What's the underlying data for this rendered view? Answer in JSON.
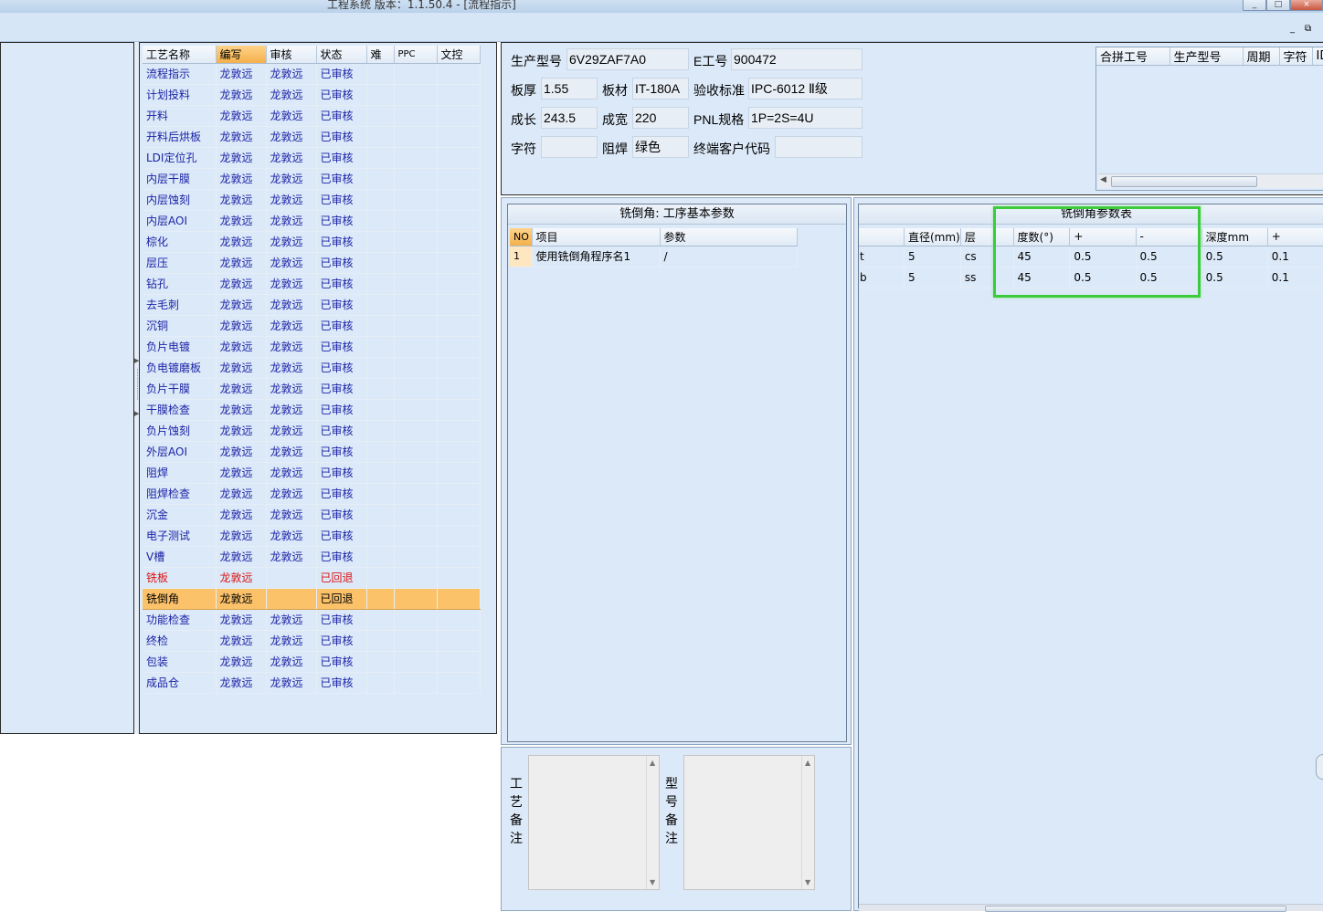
{
  "window": {
    "title": "工程系统   版本：1.1.50.4 - [流程指示]",
    "controls": [
      "_",
      "□",
      "×"
    ],
    "mdi_controls": [
      "_",
      "⧉"
    ]
  },
  "process_grid": {
    "headers": [
      "工艺名称",
      "编写",
      "审核",
      "状态",
      "难",
      "PPC",
      "文控"
    ],
    "rows": [
      {
        "name": "流程指示",
        "writer": "龙敦远",
        "reviewer": "龙敦远",
        "status": "已审核"
      },
      {
        "name": "计划投料",
        "writer": "龙敦远",
        "reviewer": "龙敦远",
        "status": "已审核"
      },
      {
        "name": "开料",
        "writer": "龙敦远",
        "reviewer": "龙敦远",
        "status": "已审核"
      },
      {
        "name": "开料后烘板",
        "writer": "龙敦远",
        "reviewer": "龙敦远",
        "status": "已审核"
      },
      {
        "name": "LDI定位孔",
        "writer": "龙敦远",
        "reviewer": "龙敦远",
        "status": "已审核"
      },
      {
        "name": "内层干膜",
        "writer": "龙敦远",
        "reviewer": "龙敦远",
        "status": "已审核"
      },
      {
        "name": "内层蚀刻",
        "writer": "龙敦远",
        "reviewer": "龙敦远",
        "status": "已审核"
      },
      {
        "name": "内层AOI",
        "writer": "龙敦远",
        "reviewer": "龙敦远",
        "status": "已审核"
      },
      {
        "name": "棕化",
        "writer": "龙敦远",
        "reviewer": "龙敦远",
        "status": "已审核"
      },
      {
        "name": "层压",
        "writer": "龙敦远",
        "reviewer": "龙敦远",
        "status": "已审核"
      },
      {
        "name": "钻孔",
        "writer": "龙敦远",
        "reviewer": "龙敦远",
        "status": "已审核"
      },
      {
        "name": "去毛刺",
        "writer": "龙敦远",
        "reviewer": "龙敦远",
        "status": "已审核"
      },
      {
        "name": "沉铜",
        "writer": "龙敦远",
        "reviewer": "龙敦远",
        "status": "已审核"
      },
      {
        "name": "负片电镀",
        "writer": "龙敦远",
        "reviewer": "龙敦远",
        "status": "已审核"
      },
      {
        "name": "负电镀磨板",
        "writer": "龙敦远",
        "reviewer": "龙敦远",
        "status": "已审核"
      },
      {
        "name": "负片干膜",
        "writer": "龙敦远",
        "reviewer": "龙敦远",
        "status": "已审核"
      },
      {
        "name": "干膜检查",
        "writer": "龙敦远",
        "reviewer": "龙敦远",
        "status": "已审核"
      },
      {
        "name": "负片蚀刻",
        "writer": "龙敦远",
        "reviewer": "龙敦远",
        "status": "已审核"
      },
      {
        "name": "外层AOI",
        "writer": "龙敦远",
        "reviewer": "龙敦远",
        "status": "已审核"
      },
      {
        "name": "阻焊",
        "writer": "龙敦远",
        "reviewer": "龙敦远",
        "status": "已审核"
      },
      {
        "name": "阻焊检查",
        "writer": "龙敦远",
        "reviewer": "龙敦远",
        "status": "已审核"
      },
      {
        "name": "沉金",
        "writer": "龙敦远",
        "reviewer": "龙敦远",
        "status": "已审核"
      },
      {
        "name": "电子测试",
        "writer": "龙敦远",
        "reviewer": "龙敦远",
        "status": "已审核"
      },
      {
        "name": "V槽",
        "writer": "龙敦远",
        "reviewer": "龙敦远",
        "status": "已审核"
      },
      {
        "name": "铣板",
        "writer": "龙敦远",
        "reviewer": "",
        "status": "已回退",
        "state": "red"
      },
      {
        "name": "铣倒角",
        "writer": "龙敦远",
        "reviewer": "",
        "status": "已回退",
        "state": "selected"
      },
      {
        "name": "功能检查",
        "writer": "龙敦远",
        "reviewer": "龙敦远",
        "status": "已审核"
      },
      {
        "name": "终检",
        "writer": "龙敦远",
        "reviewer": "龙敦远",
        "status": "已审核"
      },
      {
        "name": "包装",
        "writer": "龙敦远",
        "reviewer": "龙敦远",
        "status": "已审核"
      },
      {
        "name": "成品仓",
        "writer": "龙敦远",
        "reviewer": "龙敦远",
        "status": "已审核"
      }
    ]
  },
  "info": {
    "model_label": "生产型号",
    "model": "6V29ZAF7A0",
    "eno_label": "E工号",
    "eno": "900472",
    "thickness_label": "板厚",
    "thickness": "1.55",
    "material_label": "板材",
    "material": "IT-180A",
    "standard_label": "验收标准",
    "standard": "IPC-6012 Ⅱ级",
    "length_label": "成长",
    "length": "243.5",
    "width_label": "成宽",
    "width": "220",
    "pnl_label": "PNL规格",
    "pnl": "1P=2S=4U",
    "char_label": "字符",
    "char": "",
    "mask_label": "阻焊",
    "mask": "绿色",
    "customer_label": "终端客户代码",
    "customer": ""
  },
  "combined_grid": {
    "headers": [
      "合拼工号",
      "生产型号",
      "周期",
      "字符",
      "ID"
    ]
  },
  "basic_params": {
    "title": "铣倒角: 工序基本参数",
    "headers": [
      "NO",
      "项目",
      "参数"
    ],
    "rows": [
      {
        "no": "1",
        "item": "使用铣倒角程序名1",
        "param": "/"
      }
    ]
  },
  "chamfer_table": {
    "title": "铣倒角参数表",
    "headers": [
      "",
      "直径(mm)",
      "层",
      "度数(°)",
      "+",
      "-",
      "深度mm",
      "+"
    ],
    "rows": [
      [
        "t",
        "5",
        "cs",
        "45",
        "0.5",
        "0.5",
        "0.5",
        "0.1"
      ],
      [
        "b",
        "5",
        "ss",
        "45",
        "0.5",
        "0.5",
        "0.5",
        "0.1"
      ]
    ]
  },
  "remarks": {
    "process_label": "工艺备注",
    "model_label": "型号备注",
    "process_text": "",
    "model_text": ""
  },
  "colors": {
    "panel_bg": "#dce9f8",
    "link_text": "#1a23a6",
    "error_text": "#d91616",
    "selection": "#fbc26a",
    "highlight_box": "#3ccb3c"
  }
}
